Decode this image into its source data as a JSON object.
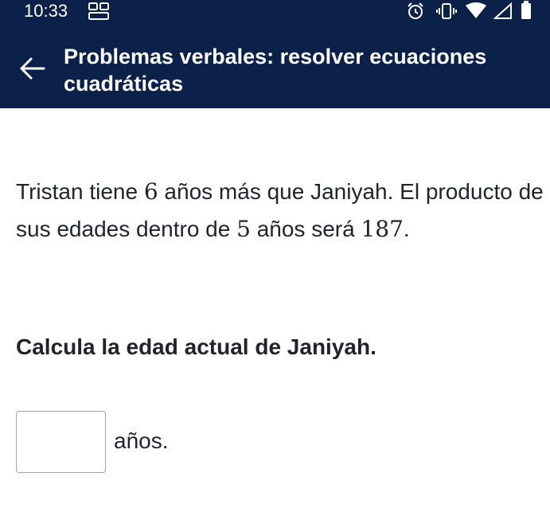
{
  "status_bar": {
    "time": "10:33",
    "icons": [
      "gallery-icon",
      "alarm-icon",
      "vibrate-icon",
      "wifi-icon",
      "signal-icon",
      "battery-icon"
    ]
  },
  "header": {
    "title": "Problemas verbales: resolver ecuaciones cuadráticas",
    "back_icon": "arrow-left-icon",
    "background": "#0b2149"
  },
  "problem": {
    "text_1": "Tristan tiene ",
    "num_1": "6",
    "text_2": " años más que Janiyah. El producto de sus edades dentro de ",
    "num_2": "5",
    "text_3": " años será ",
    "num_3": "187",
    "text_4": "."
  },
  "question": {
    "text": "Calcula la edad actual de Janiyah."
  },
  "answer": {
    "value": "",
    "placeholder": "",
    "unit": "años."
  }
}
